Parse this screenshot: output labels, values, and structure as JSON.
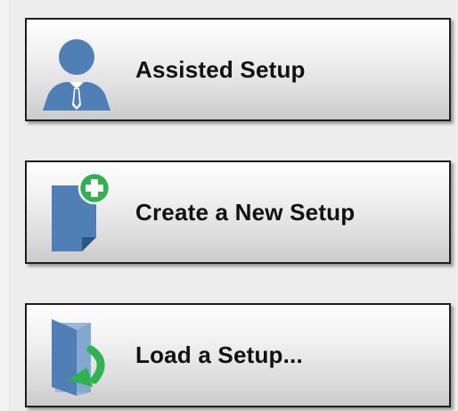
{
  "colors": {
    "icon_blue": "#4f7fb5",
    "icon_green": "#2eb34f",
    "button_border": "#1e1e1e",
    "label_text": "#111111"
  },
  "buttons": [
    {
      "label": "Assisted Setup",
      "icon": "person-icon"
    },
    {
      "label": "Create a New Setup",
      "icon": "new-document-icon"
    },
    {
      "label": "Load a Setup...",
      "icon": "open-door-icon"
    }
  ]
}
